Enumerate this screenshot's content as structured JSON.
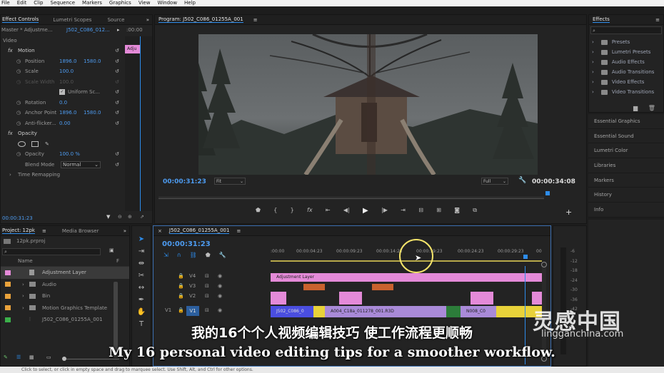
{
  "menu": [
    "File",
    "Edit",
    "Clip",
    "Sequence",
    "Markers",
    "Graphics",
    "View",
    "Window",
    "Help"
  ],
  "effect_controls": {
    "tabs": [
      "Effect Controls",
      "Lumetri Scopes",
      "Source"
    ],
    "master_label": "Master * Adjustme...",
    "clip_label": "J502_C086_012...",
    "clip_chip": "Adju",
    "section_video": "Video",
    "rows": [
      {
        "label": "Motion",
        "v1": "",
        "v2": ""
      },
      {
        "label": "Position",
        "v1": "1896.0",
        "v2": "1580.0"
      },
      {
        "label": "Scale",
        "v1": "100.0",
        "v2": ""
      },
      {
        "label": "Scale Width",
        "v1": "100.0",
        "v2": ""
      },
      {
        "label": "Uniform Sc...",
        "v1": "",
        "v2": ""
      },
      {
        "label": "Rotation",
        "v1": "0.0",
        "v2": ""
      },
      {
        "label": "Anchor Point",
        "v1": "1896.0",
        "v2": "1580.0"
      },
      {
        "label": "Anti-flicker...",
        "v1": "0.00",
        "v2": ""
      },
      {
        "label": "Opacity",
        "v1": "",
        "v2": ""
      },
      {
        "label": "",
        "v1": "",
        "v2": ""
      },
      {
        "label": "Opacity",
        "v1": "100.0 %",
        "v2": ""
      },
      {
        "label": "Blend Mode",
        "v1": "Normal",
        "v2": ""
      },
      {
        "label": "Time Remapping",
        "v1": "",
        "v2": ""
      }
    ],
    "timecode": "00:00:31:23"
  },
  "program": {
    "title": "Program: J502_C086_01255A_001",
    "timecode_current": "00:00:31:23",
    "fit": "Fit",
    "quality": "Full",
    "timecode_duration": "00:00:34:08"
  },
  "effects_panel": {
    "title": "Effects",
    "items": [
      "Presets",
      "Lumetri Presets",
      "Audio Effects",
      "Audio Transitions",
      "Video Effects",
      "Video Transitions"
    ],
    "panels": [
      "Essential Graphics",
      "Essential Sound",
      "Lumetri Color",
      "Libraries",
      "Markers",
      "History",
      "Info"
    ]
  },
  "project": {
    "tabs": [
      "Project: 12pk",
      "Media Browser"
    ],
    "file": "12pk.prproj",
    "col_name": "Name",
    "items": [
      {
        "name": "Adjustment Layer",
        "color": "#e48ad8"
      },
      {
        "name": "Audio",
        "color": "#e9a23b"
      },
      {
        "name": "Bin",
        "color": "#e9a23b"
      },
      {
        "name": "Motion Graphics Template",
        "color": "#e9a23b"
      },
      {
        "name": "J502_C086_01255A_001",
        "color": "#3bb04a"
      }
    ]
  },
  "timeline": {
    "sequence": "J502_C086_01255A_001",
    "timecode": "00:00:31:23",
    "ruler": [
      ":00:00",
      "00:00:04:23",
      "00:00:09:23",
      "00:00:14:23",
      "00:00:19:23",
      "00:00:24:23",
      "00:00:29:23",
      "00"
    ],
    "tracks": [
      "V4",
      "V3",
      "V2",
      "V1"
    ],
    "v1_src": "V1",
    "adjustment_clip": "Adjustment Layer",
    "v1_clips": [
      "J502_C086_0",
      "A004_C18a_011278_001.R3D",
      "N008_C0"
    ],
    "meter_labels": [
      "-6",
      "-12",
      "-18",
      "-24",
      "-30",
      "-36",
      "-42"
    ]
  },
  "subtitles": {
    "cn": "我的16个个人视频编辑技巧 使工作流程更顺畅",
    "en": "My 16 personal video editing tips for a smoother workflow."
  },
  "watermark": {
    "cn": "灵感中国",
    "en": "lingganchina.com"
  },
  "statusbar": "Click to select, or click in empty space and drag to marquee select. Use Shift, Alt, and Ctrl for other options."
}
